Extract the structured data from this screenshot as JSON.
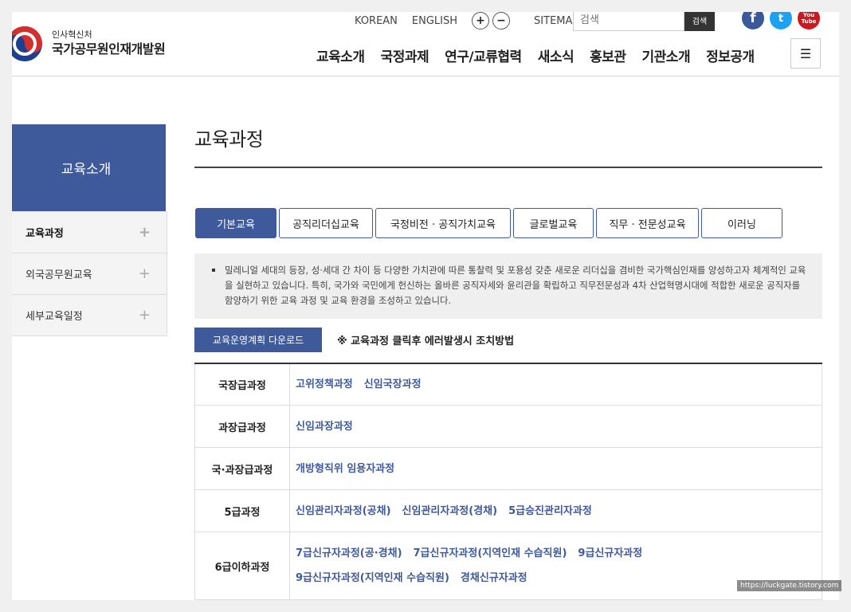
{
  "header": {
    "logo_small": "인사혁신처",
    "logo_big": "국가공무원인재개발원",
    "util": {
      "korean": "KOREAN",
      "english": "ENGLISH",
      "zoom_in": "+",
      "zoom_out": "−",
      "sitemap": "SITEMAP"
    },
    "search": {
      "placeholder": "검색",
      "button": "검색"
    },
    "social": {
      "facebook": "f",
      "twitter": "t",
      "youtube": "You Tube"
    },
    "gnb": [
      "교육소개",
      "국정과제",
      "연구/교류협력",
      "새소식",
      "홍보관",
      "기관소개",
      "정보공개"
    ],
    "menu": "☰"
  },
  "sidebar": {
    "title": "교육소개",
    "items": [
      {
        "label": "교육과정",
        "active": true
      },
      {
        "label": "외국공무원교육",
        "active": false
      },
      {
        "label": "세부교육일정",
        "active": false
      }
    ],
    "plus": "+"
  },
  "main": {
    "title": "교육과정",
    "tabs": [
      {
        "label": "기본교육",
        "active": true
      },
      {
        "label": "공직리더십교육",
        "active": false
      },
      {
        "label": "국정비전 · 공직가치교육",
        "active": false
      },
      {
        "label": "글로벌교육",
        "active": false
      },
      {
        "label": "직무 · 전문성교육",
        "active": false
      },
      {
        "label": "이러닝",
        "active": false
      }
    ],
    "description": "밀레니얼 세대의 등장, 성·세대 간 차이 등 다양한 가치관에 따른 통찰력 및 포용성 갖춘 새로운 리더십을 겸비한 국가핵심인재를 양성하고자 체계적인 교육을 실현하고 있습니다. 특히, 국가와 국민에게 헌신하는 올바른 공직자세와 윤리관을 확립하고 직무전문성과 4차 산업혁명시대에 적합한 새로운 공직자를 함양하기 위한 교육 과정 및 교육 환경을 조성하고 있습니다.",
    "download_button": "교육운영계획 다운로드",
    "notice": "※ 교육과정 클릭후 에러발생시 조치방법",
    "table": [
      {
        "header": "국장급과정",
        "links": [
          "고위정책과정",
          "신임국장과정"
        ]
      },
      {
        "header": "과장급과정",
        "links": [
          "신임과장과정"
        ]
      },
      {
        "header": "국·과장급과정",
        "links": [
          "개방형직위 임용자과정"
        ]
      },
      {
        "header": "5급과정",
        "links": [
          "신임관리자과정(공채)",
          "신임관리자과정(경채)",
          "5급승진관리자과정"
        ]
      },
      {
        "header": "6급이하과정",
        "links": [
          "7급신규자과정(공·경채)",
          "7급신규자과정(지역인재 수습직원)",
          "9급신규자과정",
          "9급신규자과정(지역인재 수습직원)",
          "경채신규자과정"
        ]
      }
    ]
  },
  "watermark": "https://luckgate.tistory.com",
  "colors": {
    "accent": "#3f5a9a",
    "facebook": "#3b5998",
    "twitter": "#1da1f2",
    "youtube": "#cc181e"
  }
}
